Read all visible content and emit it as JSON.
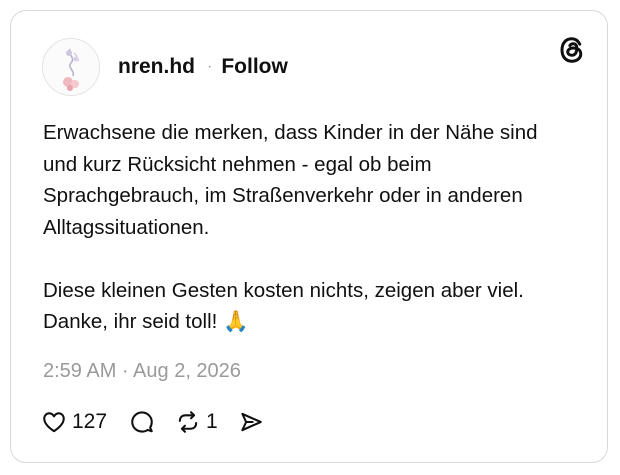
{
  "post": {
    "username": "nren.hd",
    "separator": "·",
    "follow_label": "Follow",
    "paragraphs": [
      "Erwachsene die merken, dass Kinder in der Nähe sind und kurz Rücksicht nehmen - egal ob beim Sprachgebrauch, im Straßenverkehr oder in anderen Alltagssituationen.",
      "Diese kleinen Gesten kosten nichts, zeigen aber viel. Danke, ihr seid toll! 🙏"
    ],
    "timestamp": "2:59 AM · Aug 2, 2026"
  },
  "actions": {
    "like_count": "127",
    "repost_count": "1"
  },
  "icons": {
    "brand": "threads-logo-icon",
    "like": "heart-icon",
    "reply": "speech-bubble-icon",
    "repost": "repost-icon",
    "share": "send-icon"
  },
  "colors": {
    "text": "#101010",
    "muted": "#9a9a9a",
    "border": "#d9d9d9"
  }
}
